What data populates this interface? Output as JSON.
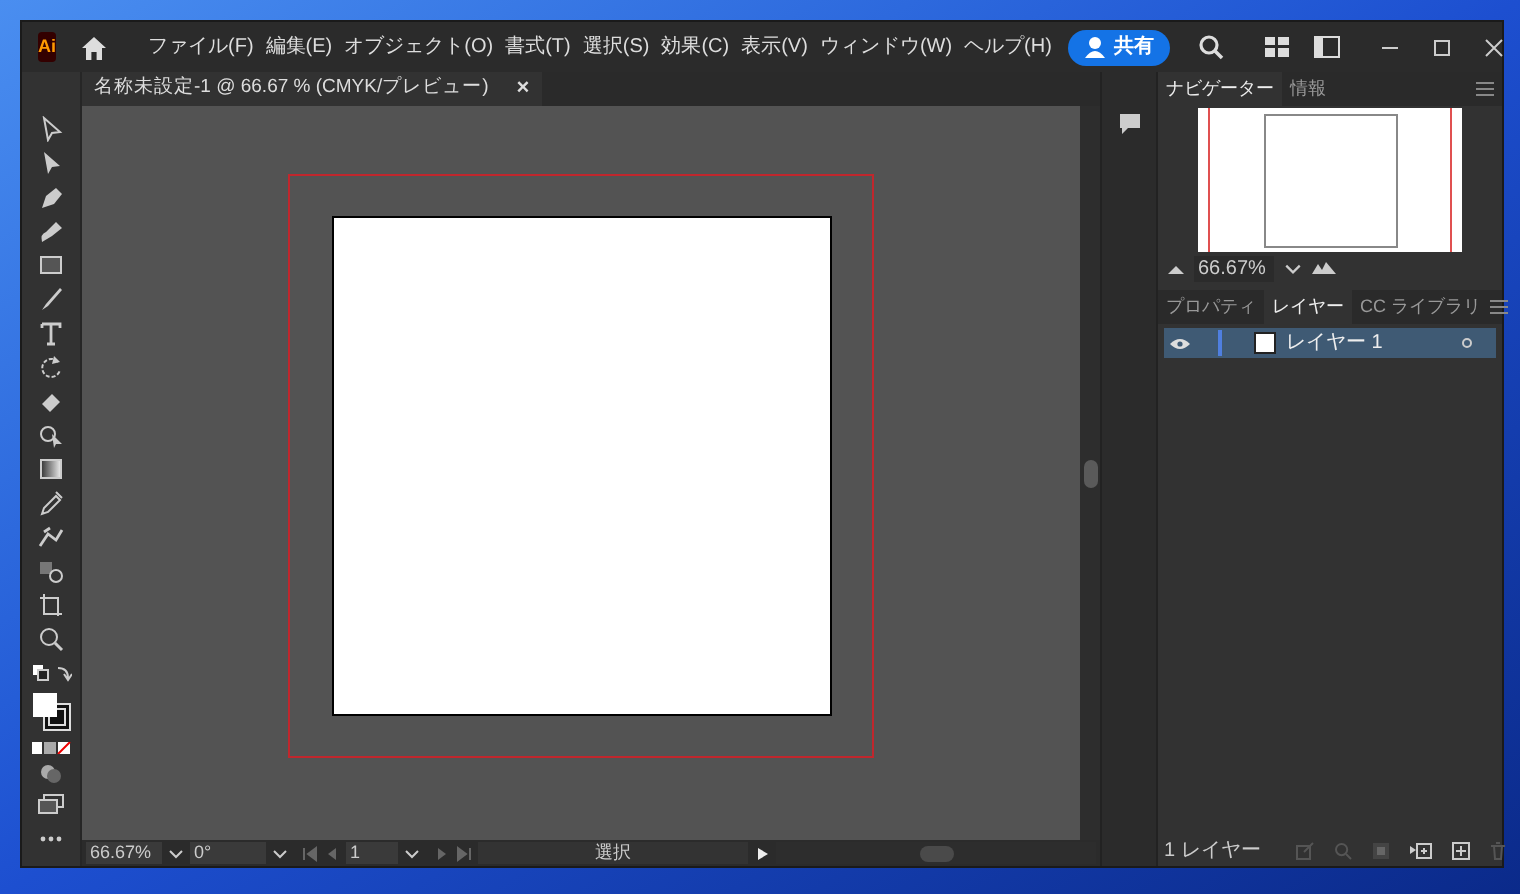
{
  "app": {
    "logo": "Ai"
  },
  "menu": [
    "ファイル(F)",
    "編集(E)",
    "オブジェクト(O)",
    "書式(T)",
    "選択(S)",
    "効果(C)",
    "表示(V)",
    "ウィンドウ(W)",
    "ヘルプ(H)"
  ],
  "share_button": "共有",
  "document_tab": {
    "title": "名称未設定-1 @ 66.67 % (CMYK/プレビュー)",
    "close": "×"
  },
  "navigator": {
    "tabs": [
      {
        "label": "ナビゲーター",
        "selected": true
      },
      {
        "label": "情報",
        "selected": false
      }
    ],
    "zoom": "66.67%"
  },
  "panel_tabs": [
    {
      "label": "プロパティ",
      "selected": false
    },
    {
      "label": "レイヤー",
      "selected": true
    },
    {
      "label": "CC ライブラリ",
      "selected": false
    }
  ],
  "layers": [
    {
      "name": "レイヤー 1",
      "visible": true,
      "selected": true
    }
  ],
  "layers_footer": "1 レイヤー",
  "status_bar": {
    "zoom": "66.67%",
    "rotation": "0°",
    "artboard": "1",
    "tool": "選択"
  }
}
